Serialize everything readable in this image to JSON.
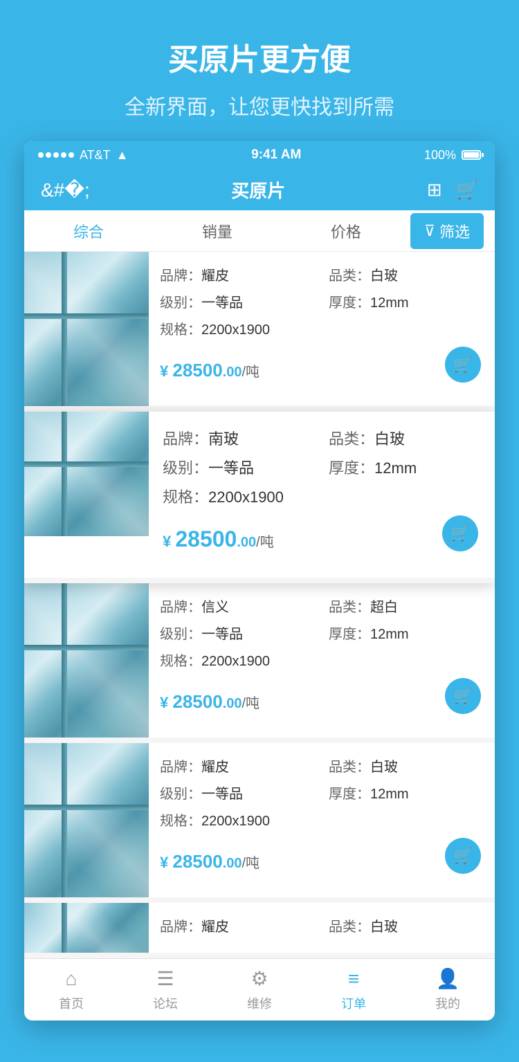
{
  "promo": {
    "title": "买原片更方便",
    "subtitle": "全新界面，让您更快找到所需"
  },
  "status_bar": {
    "carrier": "AT&T",
    "time": "9:41 AM",
    "battery": "100%"
  },
  "nav": {
    "title": "买原片",
    "back_label": "‹"
  },
  "sort_bar": {
    "items": [
      "综合",
      "销量",
      "价格"
    ],
    "active_index": 0,
    "filter_label": "筛选"
  },
  "products": [
    {
      "brand_label": "品牌：",
      "brand": "耀皮",
      "category_label": "品类：",
      "category": "白玻",
      "grade_label": "级别：",
      "grade": "一等品",
      "thickness_label": "厚度：",
      "thickness": "12mm",
      "spec_label": "规格：",
      "spec": "2200x1900",
      "price": "¥ 28500",
      "price_decimal": ".00",
      "price_unit": "/吨",
      "highlighted": false
    },
    {
      "brand_label": "品牌：",
      "brand": "南玻",
      "category_label": "品类：",
      "category": "白玻",
      "grade_label": "级别：",
      "grade": "一等品",
      "thickness_label": "厚度：",
      "thickness": "12mm",
      "spec_label": "规格：",
      "spec": "2200x1900",
      "price": "¥ 28500",
      "price_decimal": ".00",
      "price_unit": "/吨",
      "highlighted": true
    },
    {
      "brand_label": "品牌：",
      "brand": "信义",
      "category_label": "品类：",
      "category": "超白",
      "grade_label": "级别：",
      "grade": "一等品",
      "thickness_label": "厚度：",
      "thickness": "12mm",
      "spec_label": "规格：",
      "spec": "2200x1900",
      "price": "¥ 28500",
      "price_decimal": ".00",
      "price_unit": "/吨",
      "highlighted": false
    },
    {
      "brand_label": "品牌：",
      "brand": "耀皮",
      "category_label": "品类：",
      "category": "白玻",
      "grade_label": "级别：",
      "grade": "一等品",
      "thickness_label": "厚度：",
      "thickness": "12mm",
      "spec_label": "规格：",
      "spec": "2200x1900",
      "price": "¥ 28500",
      "price_decimal": ".00",
      "price_unit": "/吨",
      "highlighted": false
    },
    {
      "brand_label": "品牌：",
      "brand": "耀皮",
      "category_label": "品类：",
      "category": "白玻",
      "grade_label": "级别：",
      "grade": "",
      "thickness_label": "",
      "thickness": "",
      "spec_label": "",
      "spec": "",
      "price": "",
      "price_decimal": "",
      "price_unit": "",
      "highlighted": false,
      "partial": true
    }
  ],
  "tabs": [
    {
      "label": "首页",
      "icon": "home",
      "active": false
    },
    {
      "label": "论坛",
      "icon": "forum",
      "active": false
    },
    {
      "label": "维修",
      "icon": "repair",
      "active": false
    },
    {
      "label": "订单",
      "icon": "order",
      "active": true
    },
    {
      "label": "我的",
      "icon": "profile",
      "active": false
    }
  ]
}
